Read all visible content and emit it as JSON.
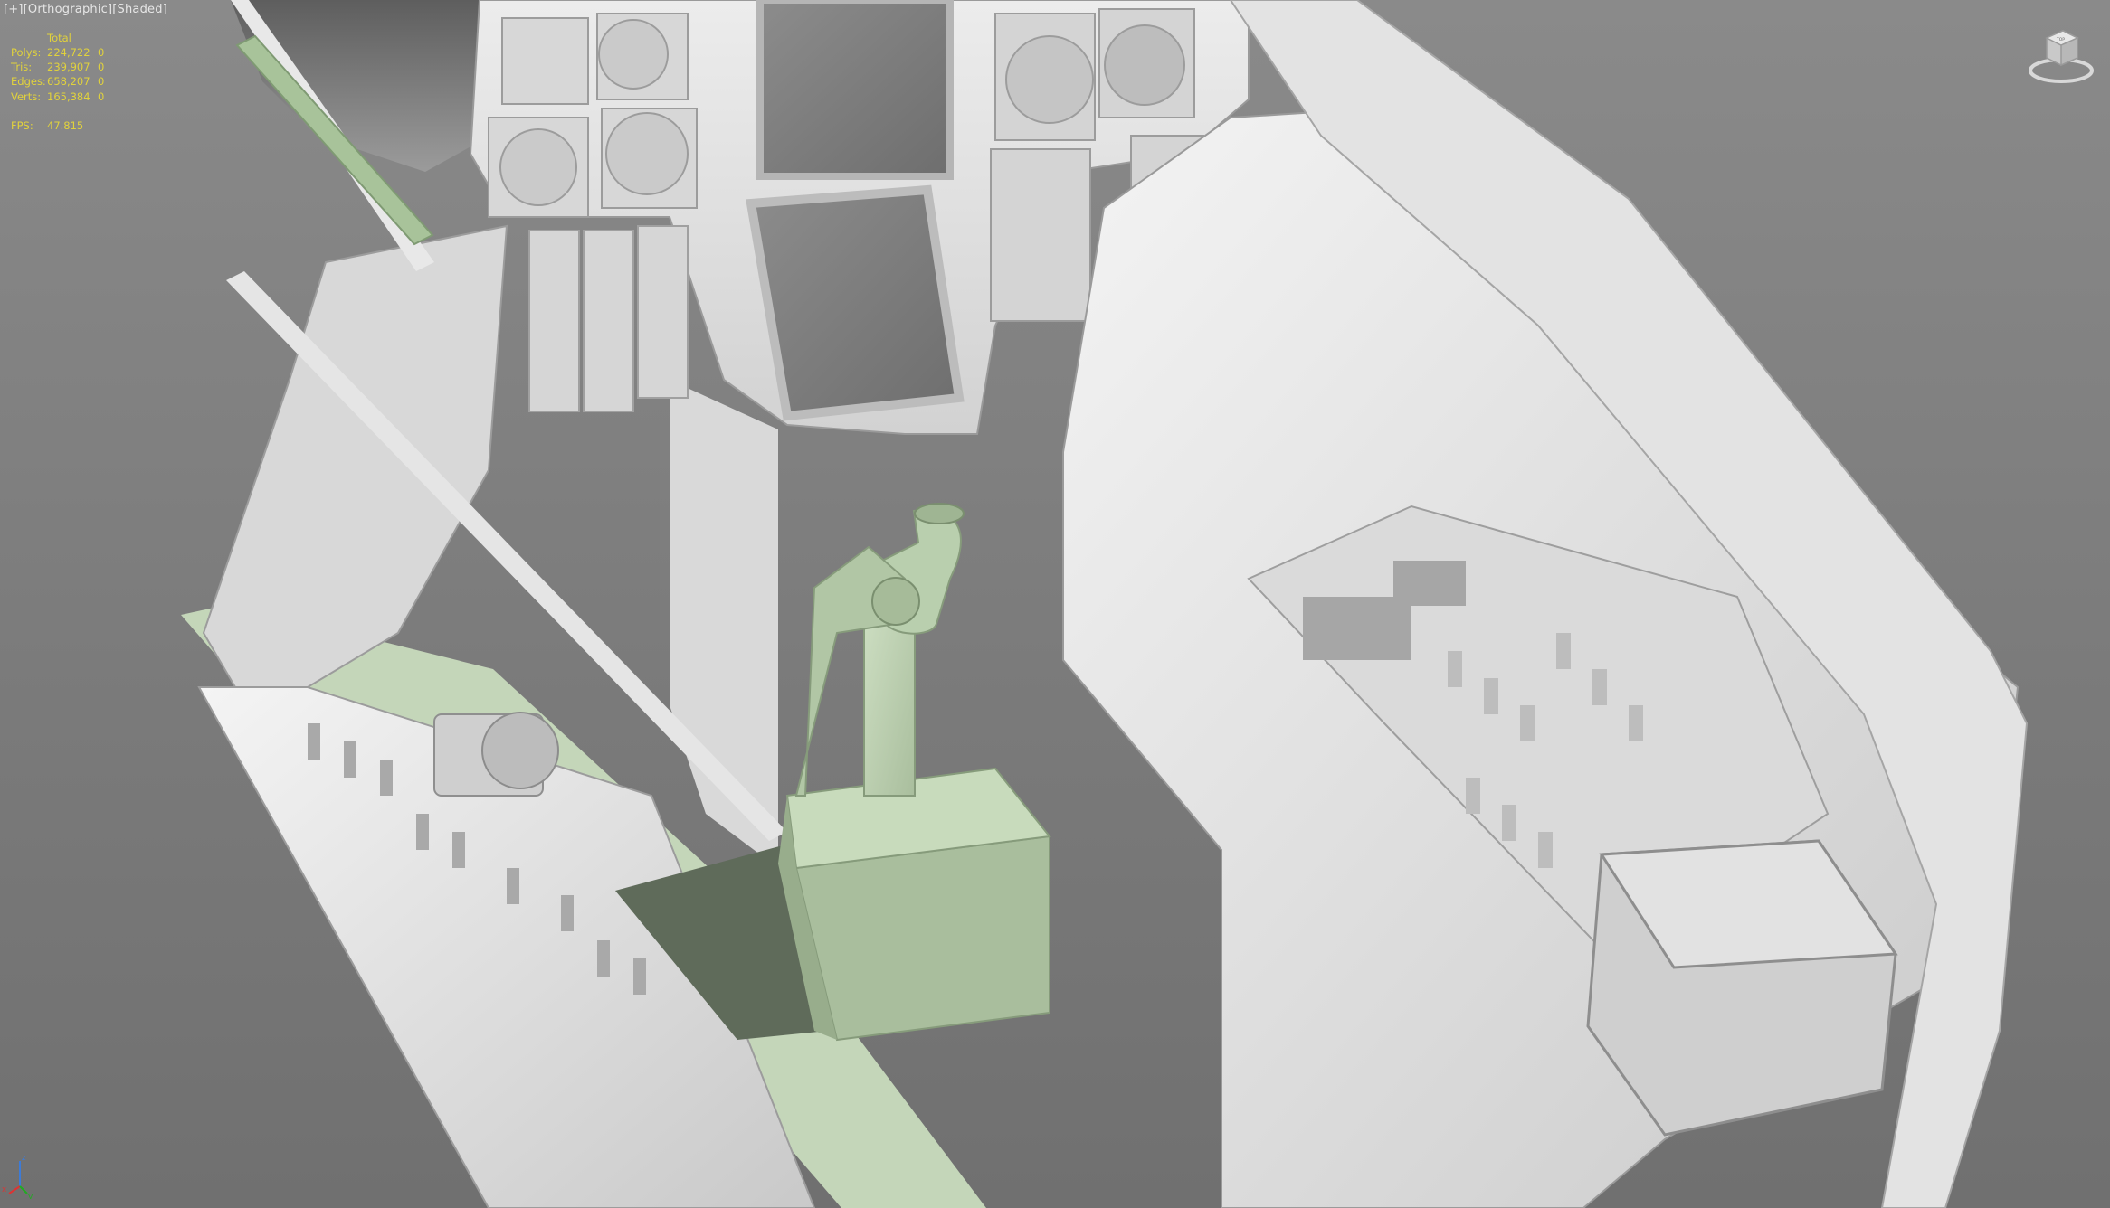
{
  "viewport": {
    "label_parts": [
      "[+]",
      "[Orthographic]",
      "[Shaded]"
    ],
    "mode": "Orthographic",
    "shading": "Shaded"
  },
  "stats": {
    "header": "Total",
    "rows": [
      {
        "label": "Polys:",
        "value": "224,722",
        "selected": "0"
      },
      {
        "label": "Tris:",
        "value": "239,907",
        "selected": "0"
      },
      {
        "label": "Edges:",
        "value": "658,207",
        "selected": "0"
      },
      {
        "label": "Verts:",
        "value": "165,384",
        "selected": "0"
      }
    ],
    "fps_label": "FPS:",
    "fps_value": "47.815"
  },
  "viewcube": {
    "face_label": "TOP"
  },
  "axis_gizmo": {
    "x": "x",
    "y": "y",
    "z": "z"
  },
  "colors": {
    "background": "#7d7d7d",
    "hud_text": "#e1d23c",
    "model_white": "#e6e6e6",
    "model_green": "#b9cfae"
  }
}
